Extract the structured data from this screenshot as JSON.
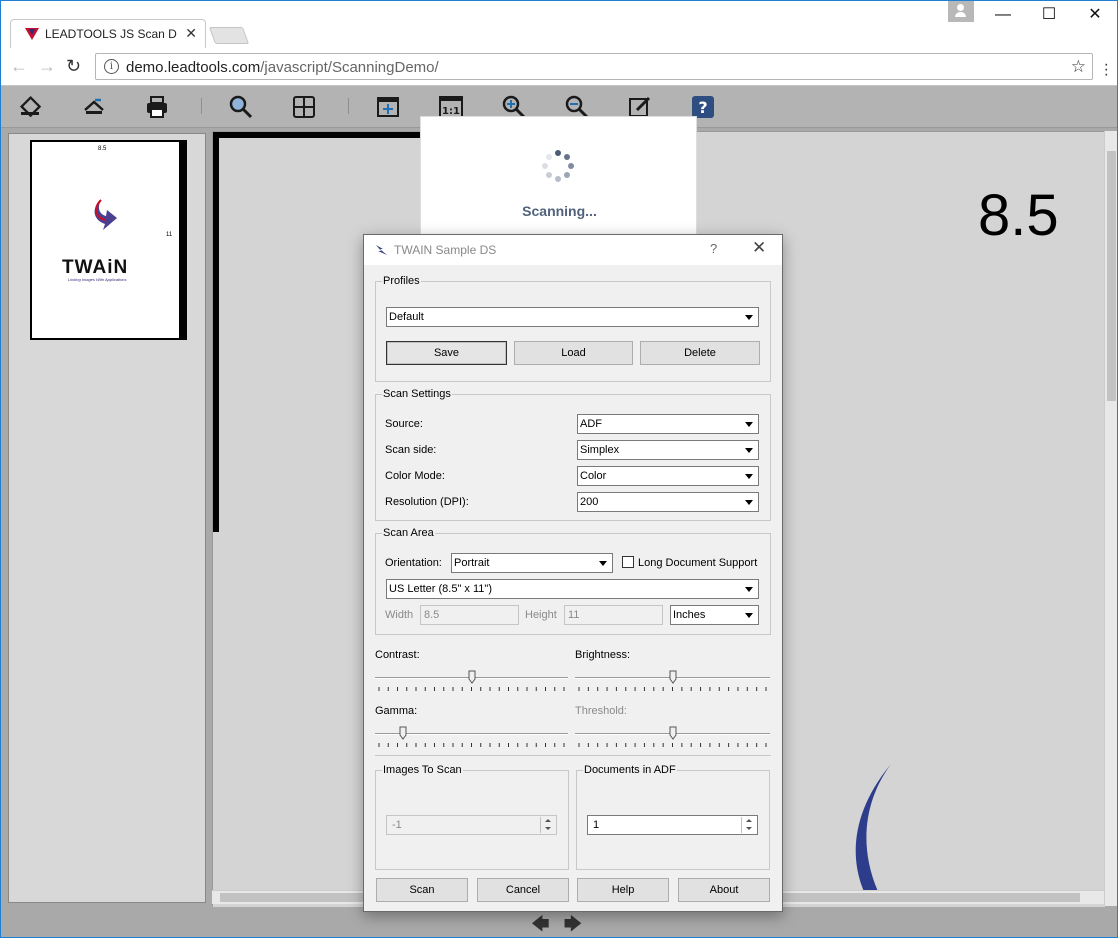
{
  "browser": {
    "tab_title": "LEADTOOLS JS Scan Demo",
    "tab_close": "✕",
    "url_host": "demo.leadtools.com",
    "url_path": "/javascript/ScanningDemo/",
    "window_controls": {
      "minimize": "—",
      "maximize": "☐",
      "close": "✕"
    }
  },
  "toolbar": {
    "icons": [
      "scanner-icon",
      "acquire-icon",
      "print-icon",
      "zoom-tool-icon",
      "grid-icon",
      "fit-page-icon",
      "actual-size-icon",
      "zoom-in-icon",
      "zoom-out-icon",
      "edit-icon",
      "help-icon"
    ]
  },
  "thumbnail": {
    "top_label": "8.5",
    "side_label": "11",
    "logo_text": "TWAiN",
    "logo_tagline": "Linking Images With Applications"
  },
  "viewer": {
    "page_label": "8.5"
  },
  "scanning_overlay": {
    "text": "Scanning..."
  },
  "dialog": {
    "title": "TWAIN Sample DS",
    "help": "?",
    "close": "✕",
    "profiles": {
      "legend": "Profiles",
      "selected": "Default",
      "save": "Save",
      "load": "Load",
      "delete": "Delete"
    },
    "scan_settings": {
      "legend": "Scan Settings",
      "source_label": "Source:",
      "source_value": "ADF",
      "side_label": "Scan side:",
      "side_value": "Simplex",
      "color_label": "Color Mode:",
      "color_value": "Color",
      "resolution_label": "Resolution (DPI):",
      "resolution_value": "200"
    },
    "scan_area": {
      "legend": "Scan Area",
      "orientation_label": "Orientation:",
      "orientation_value": "Portrait",
      "long_doc_label": "Long Document Support",
      "long_doc_checked": false,
      "paper_value": "US Letter (8.5\" x 11\")",
      "width_label": "Width",
      "width_value": "8.5",
      "height_label": "Height",
      "height_value": "11",
      "units_value": "Inches"
    },
    "adjust": {
      "contrast_label": "Contrast:",
      "contrast_level": 0.5,
      "brightness_label": "Brightness:",
      "brightness_level": 0.5,
      "gamma_label": "Gamma:",
      "gamma_level": 0.13,
      "threshold_label": "Threshold:",
      "threshold_level": 0.5
    },
    "images_to_scan": {
      "legend": "Images To Scan",
      "value": "-1"
    },
    "documents_in_adf": {
      "legend": "Documents in ADF",
      "value": "1"
    },
    "buttons": {
      "scan": "Scan",
      "cancel": "Cancel",
      "help": "Help",
      "about": "About"
    }
  },
  "pager": {
    "prev": "🡄",
    "next": "🡆"
  }
}
